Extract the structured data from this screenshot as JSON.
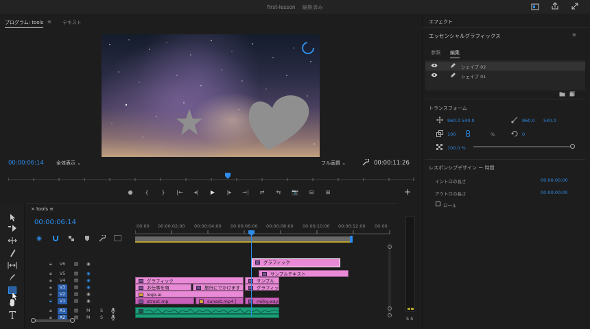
{
  "window": {
    "title": "first-lesson",
    "status": "編集済み",
    "icons": [
      "share-icon",
      "export-icon",
      "fullscreen-icon"
    ]
  },
  "program_monitor": {
    "tab_label": "プログラム: tools",
    "menu_glyph": "≡",
    "text_tab_label": "テキスト",
    "current_timecode": "00:00:06:14",
    "fit_select": "全体表示",
    "quality_select": "フル画質",
    "duration_timecode": "00:00:11:26",
    "transport": [
      "●",
      "{",
      "}",
      "|←",
      "◂|",
      "▶",
      "|▸",
      "→|",
      "⇄",
      "⇆",
      "📷",
      "⊟",
      "⊞"
    ],
    "add_glyph": "+"
  },
  "tools": [
    "selection-tool",
    "track-select-tool",
    "ripple-edit-tool",
    "razor-tool",
    "slip-tool",
    "pen-tool",
    "rectangle-tool",
    "hand-tool",
    "type-tool"
  ],
  "timeline": {
    "tab_label": "tools",
    "close_glyph": "×",
    "menu_glyph": "≡",
    "timecode": "00:00:06:14",
    "ruler": [
      "00:00",
      "00:00:02:00",
      "00:00:04:00",
      "00:00:06:00",
      "00:00:08:00",
      "00:00:10:00",
      "00:00:12:00",
      "00:00"
    ],
    "tracks": [
      {
        "name": "V6",
        "active": false
      },
      {
        "name": "V5",
        "active": false
      },
      {
        "name": "V4",
        "active": false
      },
      {
        "name": "V3",
        "active": true
      },
      {
        "name": "V2",
        "active": true
      },
      {
        "name": "V1",
        "active": true
      },
      {
        "name": "A1",
        "active": true
      },
      {
        "name": "A2",
        "active": true
      }
    ],
    "clips": [
      {
        "label": "グラフィック",
        "track": "V6"
      },
      {
        "label": "サンプルテキスト",
        "track": "V5"
      },
      {
        "label": "グラフィック",
        "track": "V4"
      },
      {
        "label": "サンプル",
        "track": "V4"
      },
      {
        "label": "お仕事を頑",
        "track": "V3"
      },
      {
        "label": "旅行にでかけます",
        "track": "V3"
      },
      {
        "label": "グラフィッ",
        "track": "V3"
      },
      {
        "label": "logo.ai",
        "track": "V2"
      },
      {
        "label": "street.mp",
        "track": "V1"
      },
      {
        "label": "sunset.mp4 [",
        "track": "V1"
      },
      {
        "label": "milky.way",
        "track": "V1"
      }
    ],
    "audio_labels": [
      "M",
      "S"
    ]
  },
  "meter": {
    "labels": "S S"
  },
  "right_panel": {
    "effects_tab": "エフェクト",
    "eg_title": "エッセンシャルグラフィックス",
    "menu_glyph": "≡",
    "browse_tab": "参照",
    "edit_tab": "編集",
    "layers": [
      "シェイプ 02",
      "シェイプ 01"
    ],
    "transform_title": "トランスフォーム",
    "position_x": "960.0",
    "position_y": "540.0",
    "anchor_x": "960.0",
    "anchor_y": "540.0",
    "scale": "100",
    "scale_unit": "%",
    "rotation": "0",
    "opacity": "100.0 %",
    "responsive_title": "レスポンシブデザイン ー 時間",
    "intro_label": "イントロの長さ",
    "intro_value": "00:00:00:00",
    "outro_label": "アウトロの長さ",
    "outro_value": "00:00:00:00",
    "roll_label": "ロール"
  }
}
